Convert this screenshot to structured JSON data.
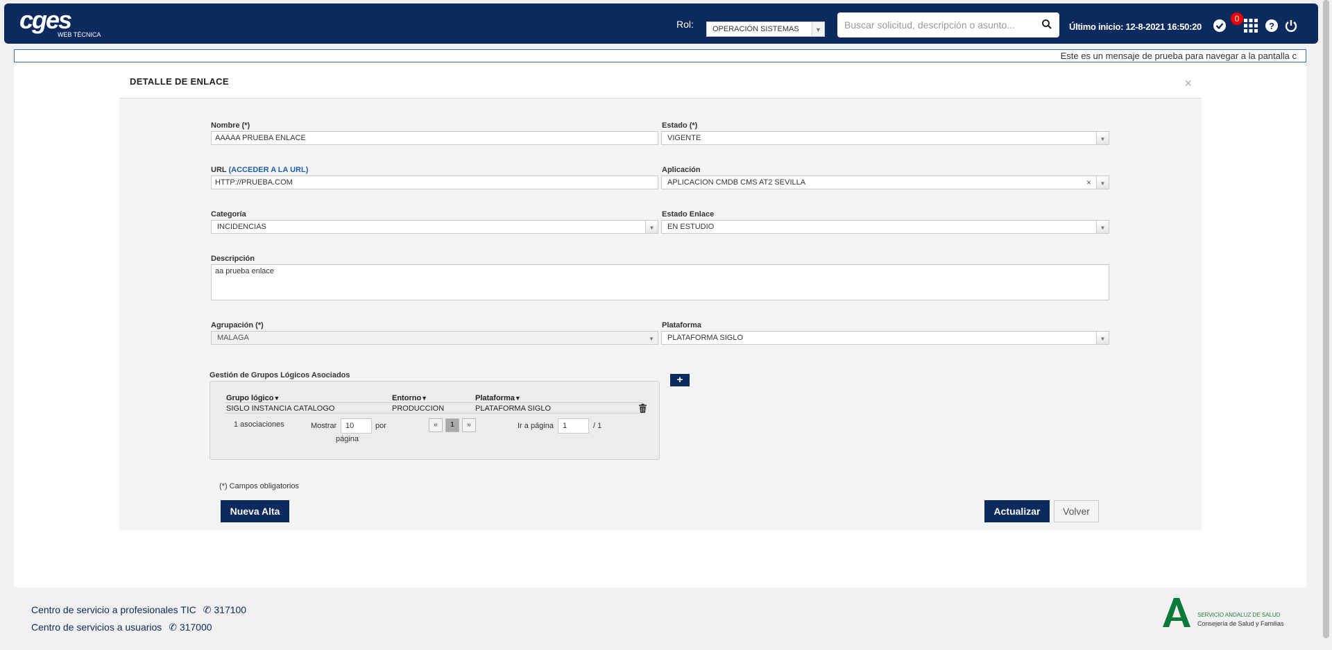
{
  "header": {
    "logo_text": "cges",
    "logo_sub": "WEB TÉCNICA",
    "rol_label": "Rol:",
    "rol_value": "OPERACIÓN SISTEMAS",
    "search_placeholder": "Buscar solicitud, descripción o asunto...",
    "last_login": "Último inicio: 12-8-2021 16:50:20",
    "badge_count": "0",
    "icons": [
      "check-circle-icon",
      "grid-apps-icon",
      "help-icon",
      "power-icon"
    ]
  },
  "marquee": "Este es un mensaje de prueba para navegar a la pantalla c",
  "modal": {
    "title": "DETALLE DE ENLACE",
    "close": "×",
    "nombre": {
      "label": "Nombre (*)",
      "value": "AAAAA PRUEBA ENLACE"
    },
    "estado": {
      "label": "Estado (*)",
      "value": "VIGENTE"
    },
    "url": {
      "label": "URL",
      "link": "(ACCEDER A LA URL)",
      "value": "HTTP://PRUEBA.COM"
    },
    "aplicacion": {
      "label": "Aplicación",
      "value": "APLICACION CMDB CMS AT2 SEVILLA"
    },
    "categoria": {
      "label": "Categoría",
      "value": "INCIDENCIAS"
    },
    "estado_enlace": {
      "label": "Estado Enlace",
      "value": "EN ESTUDIO"
    },
    "descripcion": {
      "label": "Descripción",
      "value": "aa prueba enlace"
    },
    "agrupacion": {
      "label": "Agrupación (*)",
      "value": "MALAGA"
    },
    "plataforma": {
      "label": "Plataforma",
      "value": "PLATAFORMA SIGLO"
    },
    "groups": {
      "title": "Gestión de Grupos Lógicos Asociados",
      "add": "+",
      "columns": [
        "Grupo lógico",
        "Entorno",
        "Plataforma"
      ],
      "rows": [
        {
          "grupo": "SIGLO INSTANCIA CATALOGO",
          "entorno": "PRODUCCION",
          "plataforma": "PLATAFORMA SIGLO"
        }
      ],
      "count_text": "1 asociaciones",
      "show_label": "Mostrar",
      "page_size": "10",
      "per_label": "por",
      "page_label": "página",
      "prev": "«",
      "current_page": "1",
      "next": "»",
      "goto_label": "Ir a página",
      "goto_value": "1",
      "total_pages": "/ 1"
    },
    "required_note": "(*) Campos obligatorios",
    "btn_new": "Nueva Alta",
    "btn_update": "Actualizar",
    "btn_back": "Volver"
  },
  "footer": {
    "line1": "Centro de servicio a profesionales TIC",
    "phone1": "317100",
    "line2": "Centro de servicios a usuarios",
    "phone2": "317000",
    "sas_line1": "SERVICIO ANDALUZ DE SALUD",
    "sas_line2": "Consejería de Salud y Familias"
  }
}
